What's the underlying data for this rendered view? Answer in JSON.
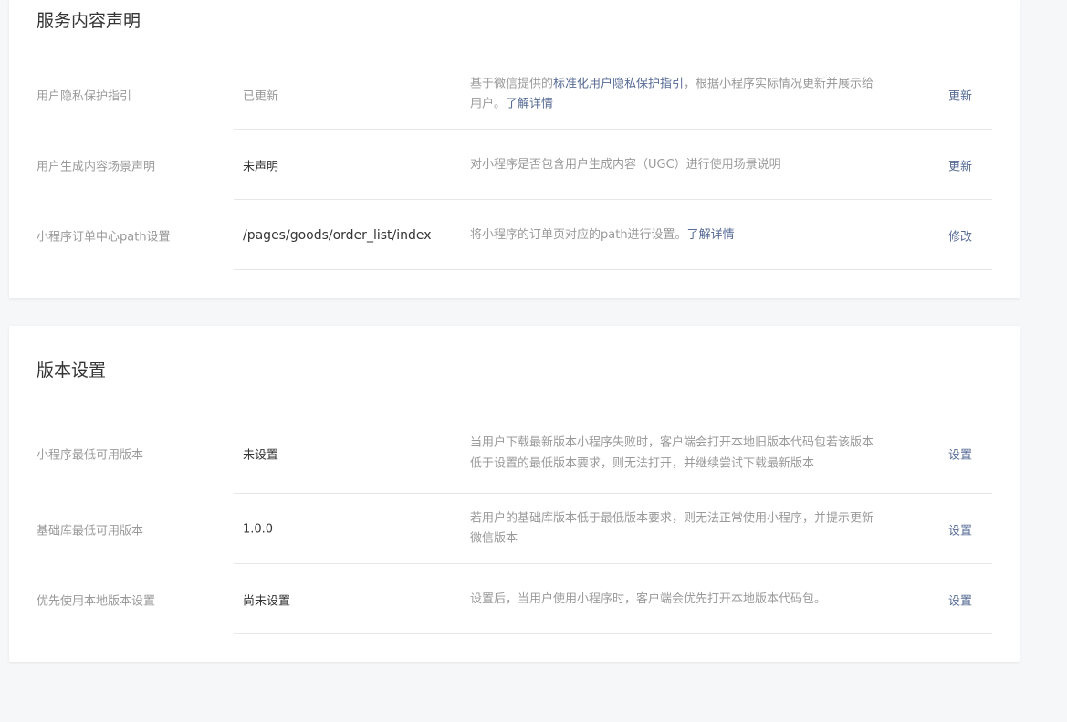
{
  "service_section": {
    "title": "服务内容声明",
    "rows": [
      {
        "label": "用户隐私保护指引",
        "value": "已更新",
        "desc_pre": "基于微信提供的",
        "desc_link1": "标准化用户隐私保护指引",
        "desc_mid": "，根据小程序实际情况更新并展示给用户。",
        "desc_link2": "了解详情",
        "action": "更新"
      },
      {
        "label": "用户生成内容场景声明",
        "value": "未声明",
        "desc": "对小程序是否包含用户生成内容（UGC）进行使用场景说明",
        "action": "更新"
      },
      {
        "label": "小程序订单中心path设置",
        "value": "/pages/goods/order_list/index",
        "desc_pre": "将小程序的订单页对应的path进行设置。",
        "desc_link": "了解详情",
        "action": "修改"
      }
    ]
  },
  "version_section": {
    "title": "版本设置",
    "rows": [
      {
        "label": "小程序最低可用版本",
        "value": "未设置",
        "desc": "当用户下载最新版本小程序失败时，客户端会打开本地旧版本代码包若该版本低于设置的最低版本要求，则无法打开，并继续尝试下载最新版本",
        "action": "设置"
      },
      {
        "label": "基础库最低可用版本",
        "value": "1.0.0",
        "desc": "若用户的基础库版本低于最低版本要求，则无法正常使用小程序，并提示更新微信版本",
        "action": "设置"
      },
      {
        "label": "优先使用本地版本设置",
        "value": "尚未设置",
        "desc": "设置后，当用户使用小程序时，客户端会优先打开本地版本代码包。",
        "action": "设置"
      }
    ]
  },
  "colors": {
    "link": "#576b95",
    "label": "#9a9a9a",
    "text": "#353535",
    "divider": "#e7e7eb",
    "page_bg": "#f6f7f9"
  }
}
